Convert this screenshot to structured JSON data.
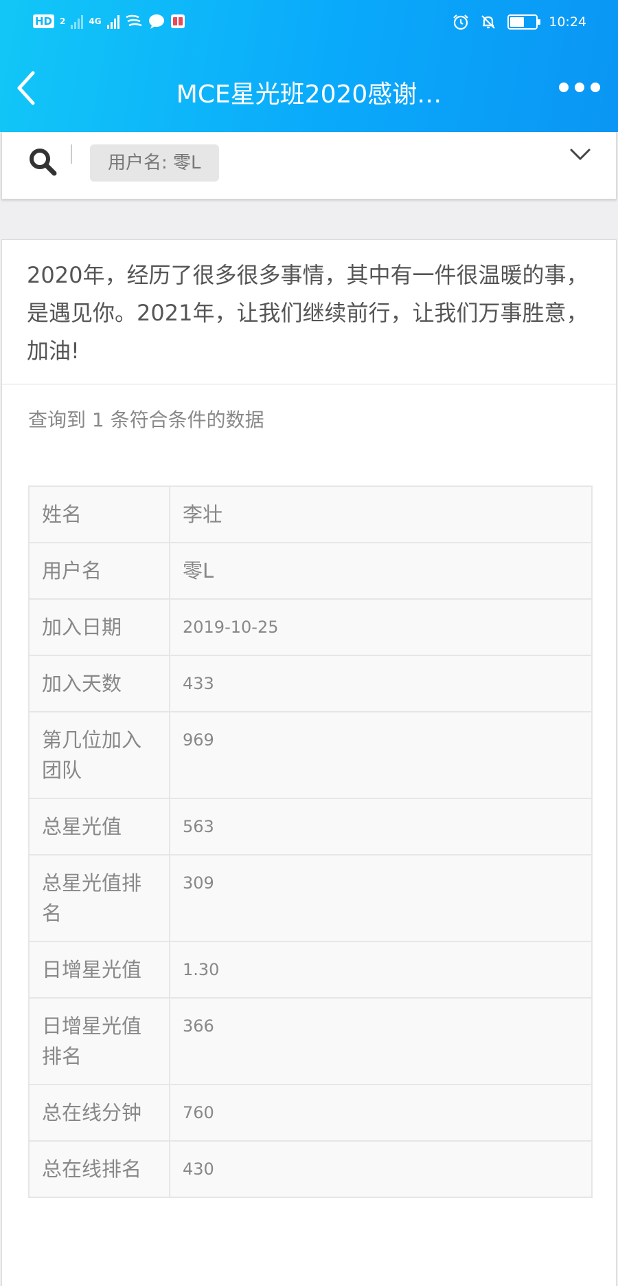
{
  "status_bar": {
    "hd_label": "HD",
    "hd_sub": "2",
    "network_label": "4G",
    "time": "10:24",
    "battery_level": 0.55,
    "icons": [
      "signal-icon",
      "wechat-icon",
      "message-icon",
      "reader-icon",
      "alarm-icon",
      "mute-icon",
      "battery-icon"
    ]
  },
  "nav": {
    "title": "MCE星光班2020感谢…",
    "back_icon": "back-arrow-icon",
    "more_icon": "more-dots-icon"
  },
  "search": {
    "filter_chip": "用户名: 零L",
    "search_icon": "search-icon",
    "expand_icon": "chevron-down-icon"
  },
  "intro_text": "2020年，经历了很多很多事情，其中有一件很温暖的事，是遇见你。2021年，让我们继续前行，让我们万事胜意，加油!",
  "result_count": "查询到 1 条符合条件的数据",
  "rows": [
    {
      "label": "姓名",
      "value": "李壮"
    },
    {
      "label": "用户名",
      "value": "零L"
    },
    {
      "label": "加入日期",
      "value": "2019-10-25"
    },
    {
      "label": "加入天数",
      "value": "433"
    },
    {
      "label": "第几位加入团队",
      "value": "969"
    },
    {
      "label": "总星光值",
      "value": "563"
    },
    {
      "label": "总星光值排名",
      "value": "309"
    },
    {
      "label": "日增星光值",
      "value": "1.30"
    },
    {
      "label": "日增星光值排名",
      "value": "366"
    },
    {
      "label": "总在线分钟",
      "value": "760"
    },
    {
      "label": "总在线排名",
      "value": "430"
    }
  ],
  "colors": {
    "header_start": "#12c7f7",
    "header_end": "#0a96f4",
    "page_bg": "#efeff2"
  }
}
